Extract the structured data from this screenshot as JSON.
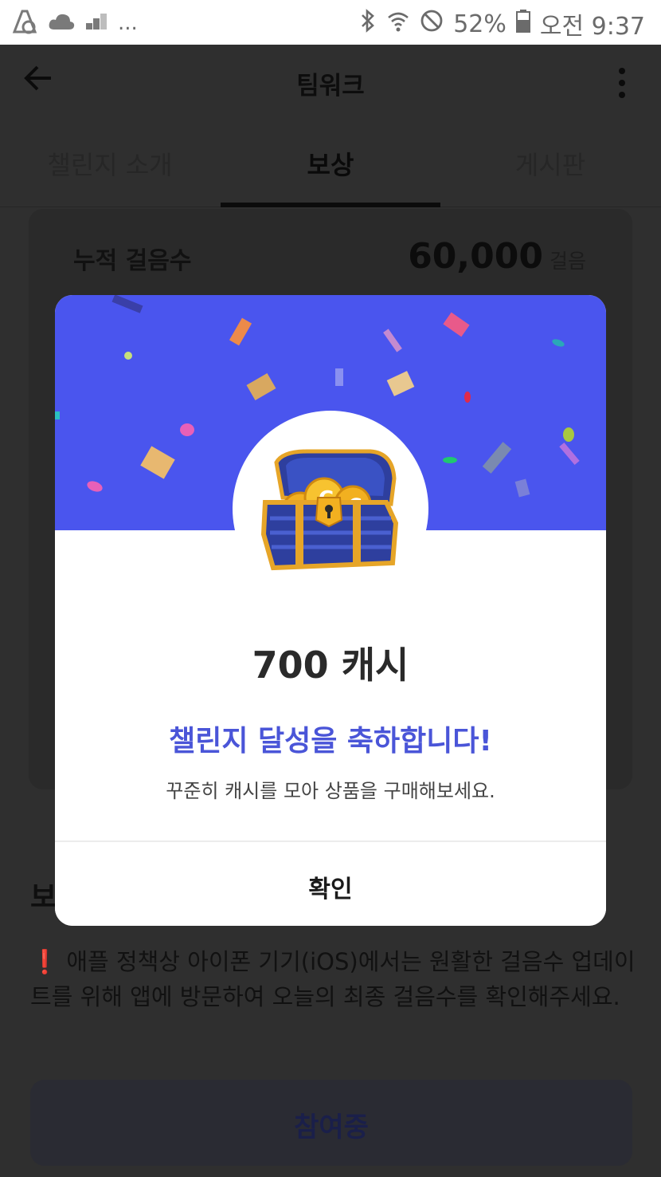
{
  "status_bar": {
    "battery": "52%",
    "time": "오전 9:37",
    "overflow": "...",
    "icons": [
      "app-logo-icon",
      "cloud-icon",
      "signal-bars-icon",
      "bluetooth-icon",
      "wifi-icon",
      "do-not-disturb-icon",
      "battery-icon"
    ]
  },
  "header": {
    "title": "팀워크",
    "back_icon": "arrow-left-icon",
    "menu_icon": "kebab-menu-icon"
  },
  "tabs": [
    {
      "label": "챌린지 소개",
      "active": false
    },
    {
      "label": "보상",
      "active": true
    },
    {
      "label": "게시판",
      "active": false
    }
  ],
  "reward_card": {
    "label": "누적 걸음수",
    "value": "60,000",
    "unit": "걸음"
  },
  "section": {
    "heading": "보",
    "notice_icon": "❗",
    "notice": "애플 정책상 아이폰 기기(iOS)에서는 원활한 걸음수 업데이트를 위해 앱에 방문하여 오늘의 최종 걸음수를 확인해주세요."
  },
  "cta": {
    "label": "참여중"
  },
  "modal": {
    "amount": "700 캐시",
    "congrats": "챌린지 달성을 축하합니다!",
    "subtext": "꾸준히 캐시를 모아 상품을 구매해보세요.",
    "confirm": "확인",
    "illustration": "treasure-chest-icon",
    "colors": {
      "banner": "#4a55ee",
      "accent": "#4a55d8"
    }
  }
}
